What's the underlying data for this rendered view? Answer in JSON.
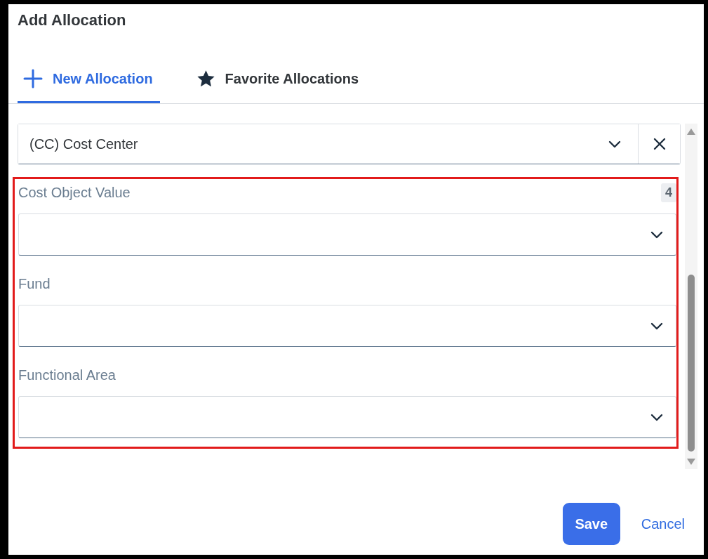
{
  "dialog": {
    "title": "Add Allocation"
  },
  "tabs": [
    {
      "label": "New Allocation",
      "kind": "new",
      "selected": true
    },
    {
      "label": "Favorite Allocations",
      "kind": "favorites",
      "selected": false
    }
  ],
  "cost_object_type": {
    "value": "(CC) Cost Center"
  },
  "section": {
    "highlighted": true,
    "badge": "4",
    "fields": [
      {
        "label": "Cost Object Value"
      },
      {
        "label": "Fund"
      },
      {
        "label": "Functional Area"
      }
    ]
  },
  "buttons": [
    {
      "label": "Save",
      "kind": "primary"
    },
    {
      "label": "Cancel",
      "kind": "link"
    }
  ]
}
